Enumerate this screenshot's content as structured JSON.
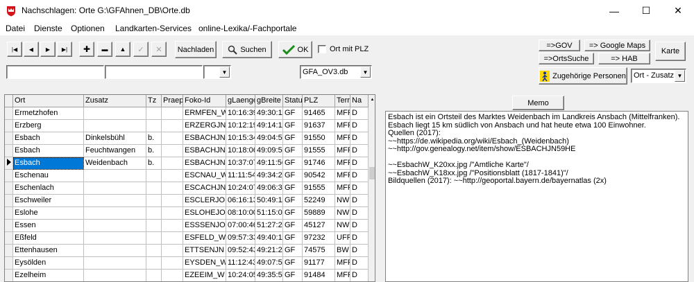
{
  "window": {
    "title": "Nachschlagen: Orte   G:\\GFAhnen_DB\\Orte.db",
    "minimize": "—",
    "maximize": "☐",
    "close": "✕"
  },
  "menu": [
    "Datei",
    "Dienste",
    "Optionen",
    "Landkarten-Services",
    "online-Lexika/-Fachportale"
  ],
  "toolbar": {
    "nav_first": "|◀",
    "nav_prev": "◀",
    "nav_next": "▶",
    "nav_last": "▶|",
    "add": "✚",
    "remove": "▬",
    "up": "▲",
    "edit": "✓",
    "cancel": "✕",
    "reload_label": "Nachladen",
    "search_label": "Suchen",
    "ok_label": "OK",
    "ort_mit_plz_label": "Ort mit PLZ",
    "gov_label": "=>GOV",
    "google_maps_label": "=> Google Maps",
    "karte_label": "Karte",
    "ortssuche_label": "=>OrtsSuche",
    "hab_label": "=> HAB",
    "zugehoerige_label": "Zugehörige Personen",
    "sort_select_value": "Ort - Zusatz",
    "db_select_value": "GFA_OV3.db",
    "filter_ort_value": "",
    "filter_zusatz_value": "",
    "filter_tz_value": ""
  },
  "colors": {
    "selection": "#0078d7",
    "ok_check": "#1a8c1a"
  },
  "grid": {
    "columns": [
      "Ort",
      "Zusatz",
      "Tz",
      "Praep",
      "Foko-Id",
      "gLaenge",
      "gBreite",
      "Status",
      "PLZ",
      "Terr",
      "Na"
    ],
    "rows": [
      [
        "Ermetzhofen",
        "",
        "",
        "",
        "ERMFEN_W",
        "10:16:39",
        "49:30:11",
        "GF",
        "91465",
        "MFR",
        "D"
      ],
      [
        "Erzberg",
        "",
        "",
        "",
        "ERZERGJN",
        "10:12:19",
        "49:14:11",
        "GF",
        "91637",
        "MFR",
        "D"
      ],
      [
        "Esbach",
        "Dinkelsbühl",
        "b.",
        "",
        "ESBACHJN",
        "10:15:34",
        "49:04:51",
        "GF",
        "91550",
        "MFR",
        "D"
      ],
      [
        "Esbach",
        "Feuchtwangen",
        "b.",
        "",
        "ESBACHJN",
        "10:18:06",
        "49:09:51",
        "GF",
        "91555",
        "MFR",
        "D"
      ],
      [
        "Esbach",
        "Weidenbach",
        "b.",
        "",
        "ESBACHJN",
        "10:37:07",
        "49:11:56",
        "GF",
        "91746",
        "MFR",
        "D"
      ],
      [
        "Eschenau",
        "",
        "",
        "",
        "ESCNAU_W",
        "11:11:54",
        "49:34:21",
        "GF",
        "90542",
        "MFR",
        "D"
      ],
      [
        "Eschenlach",
        "",
        "",
        "",
        "ESCACHJN",
        "10:24:07",
        "49:06:31",
        "GF",
        "91555",
        "MFR",
        "D"
      ],
      [
        "Eschweiler",
        "",
        "",
        "",
        "ESCLERJO",
        "06:16:13",
        "50:49:11",
        "GF",
        "52249",
        "NW",
        "D"
      ],
      [
        "Eslohe",
        "",
        "",
        "",
        "ESLOHEJO",
        "08:10:00",
        "51:15:01",
        "GF",
        "59889",
        "NW",
        "D"
      ],
      [
        "Essen",
        "",
        "",
        "",
        "ESSSENJO",
        "07:00:46",
        "51:27:21",
        "GF",
        "45127",
        "NW",
        "D"
      ],
      [
        "Eßfeld",
        "",
        "",
        "",
        "ESFELD_W",
        "09:57:33",
        "49:40:11",
        "GF",
        "97232",
        "UFR",
        "D"
      ],
      [
        "Ettenhausen",
        "",
        "",
        "",
        "ETTSENJN",
        "09:52:43",
        "49:21:21",
        "GF",
        "74575",
        "BW",
        "D"
      ],
      [
        "Eysölden",
        "",
        "",
        "",
        "EYSDEN_W",
        "11:12:43",
        "49:07:51",
        "GF",
        "91177",
        "MFR",
        "D"
      ],
      [
        "Ezelheim",
        "",
        "",
        "",
        "EZEEIM_W",
        "10:24:05",
        "49:35:51",
        "GF",
        "91484",
        "MFR",
        "D"
      ]
    ],
    "selected_row": 4
  },
  "memo": {
    "button_label": "Memo",
    "text": "Esbach ist ein Ortsteil des Marktes Weidenbach im Landkreis Ansbach (Mittelfranken).\nEsbach liegt 15 km südlich von Ansbach und hat heute etwa 100 Einwohner.\nQuellen (2017):\n~~https://de.wikipedia.org/wiki/Esbach_(Weidenbach)\n~~http://gov.genealogy.net/item/show/ESBACHJN59HE\n\n~~EsbachW_K20xx.jpg /\"Amtliche Karte\"/\n~~EsbachW_K18xx.jpg /\"Positionsblatt (1817-1841)\"/\nBildquellen (2017): ~~http://geoportal.bayern.de/bayernatlas (2x)"
  }
}
